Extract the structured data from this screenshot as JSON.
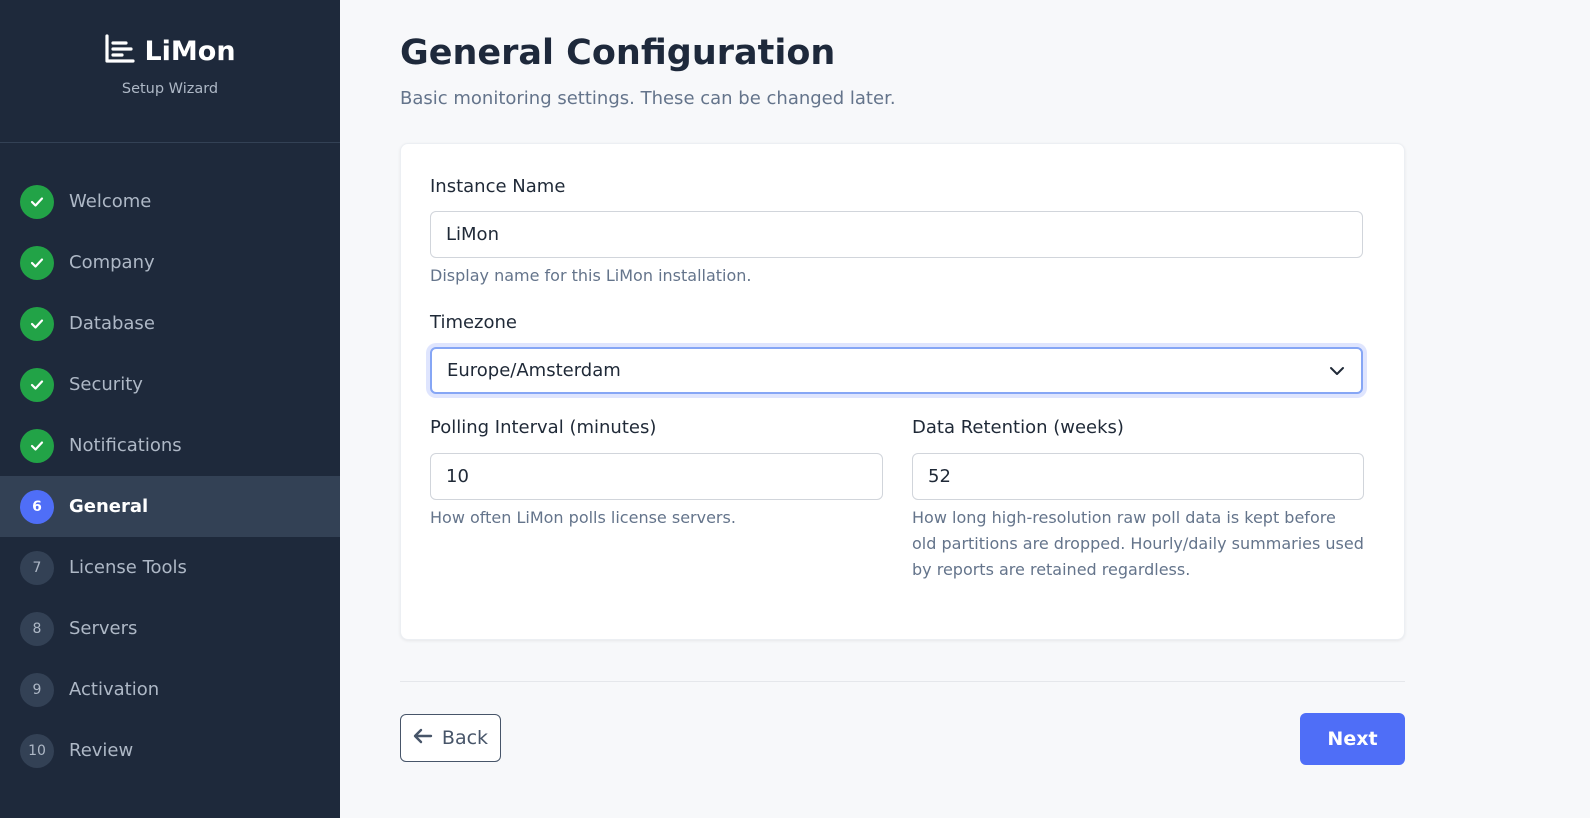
{
  "brand": {
    "name": "LiMon",
    "subtitle": "Setup Wizard"
  },
  "steps": [
    {
      "number": "1",
      "label": "Welcome",
      "state": "done"
    },
    {
      "number": "2",
      "label": "Company",
      "state": "done"
    },
    {
      "number": "3",
      "label": "Database",
      "state": "done"
    },
    {
      "number": "4",
      "label": "Security",
      "state": "done"
    },
    {
      "number": "5",
      "label": "Notifications",
      "state": "done"
    },
    {
      "number": "6",
      "label": "General",
      "state": "active"
    },
    {
      "number": "7",
      "label": "License Tools",
      "state": "todo"
    },
    {
      "number": "8",
      "label": "Servers",
      "state": "todo"
    },
    {
      "number": "9",
      "label": "Activation",
      "state": "todo"
    },
    {
      "number": "10",
      "label": "Review",
      "state": "todo"
    }
  ],
  "page": {
    "title": "General Configuration",
    "subtitle": "Basic monitoring settings. These can be changed later."
  },
  "form": {
    "instance_name": {
      "label": "Instance Name",
      "value": "LiMon",
      "help": "Display name for this LiMon installation."
    },
    "timezone": {
      "label": "Timezone",
      "value": "Europe/Amsterdam"
    },
    "polling_interval": {
      "label": "Polling Interval (minutes)",
      "value": "10",
      "help": "How often LiMon polls license servers."
    },
    "data_retention": {
      "label": "Data Retention (weeks)",
      "value": "52",
      "help": "How long high-resolution raw poll data is kept before old partitions are dropped. Hourly/daily summaries used by reports are retained regardless."
    }
  },
  "nav": {
    "back_label": "Back",
    "next_label": "Next"
  },
  "colors": {
    "sidebar_bg": "#1e293b",
    "accent": "#4f6ef7",
    "done_green": "#22a347"
  }
}
